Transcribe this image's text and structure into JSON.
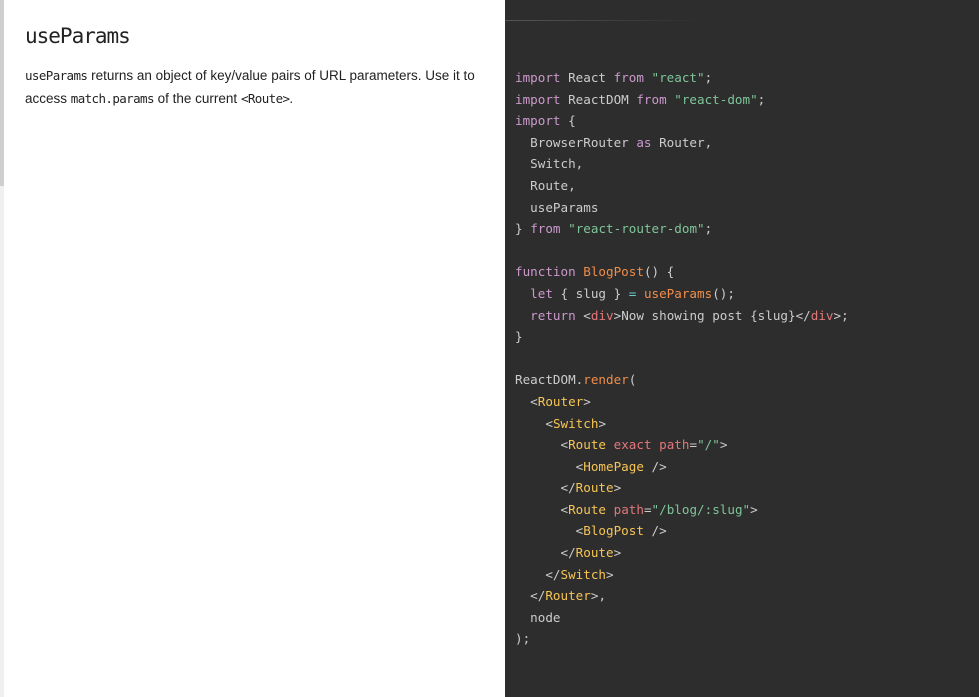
{
  "doc": {
    "title": "useParams",
    "desc_code1": "useParams",
    "desc_text1": " returns an object of key/value pairs of URL parameters. Use it to access ",
    "desc_code2": "match.params",
    "desc_text2": " of the current ",
    "desc_code3": "<Route>",
    "desc_text3": "."
  },
  "code": {
    "import_kw": "import",
    "from_kw": "from",
    "react_ident": " React ",
    "react_str": "\"react\"",
    "reactdom_ident": " ReactDOM ",
    "reactdom_str": "\"react-dom\"",
    "brace_open": " {",
    "browser_router": "BrowserRouter",
    "as_kw": "as",
    "router_alias": " Router,",
    "switch_item": "Switch,",
    "route_item": "Route,",
    "useparams_item": "useParams",
    "brace_close": "}",
    "rrd_str": "\"react-router-dom\"",
    "semicolon": ";",
    "function_kw": "function",
    "blogpost_fn": "BlogPost",
    "fn_sig_rest": "() {",
    "let_kw": "let",
    "destructure": " { slug } ",
    "eq": "=",
    "useparams_call": "useParams",
    "call_end": "();",
    "return_kw": "return",
    "lt": "<",
    "gt": ">",
    "close_lt": "</",
    "div_tag": "div",
    "now_showing": "Now showing post {slug}",
    "close_brace": "}",
    "reactdom_obj": "ReactDOM",
    "dot": ".",
    "render_fn": "render",
    "open_paren": "(",
    "router_tag": "Router",
    "switch_tag": "Switch",
    "route_tag": "Route",
    "exact_attr": "exact",
    "path_attr": "path",
    "attr_eq": "=",
    "root_path": "\"/\"",
    "homepage_tag": "HomePage",
    "self_close": " />",
    "blog_path": "\"/blog/:slug\"",
    "blogpost_tag": "BlogPost",
    "comma": ",",
    "node_ident": "node",
    "end_call": ");"
  }
}
